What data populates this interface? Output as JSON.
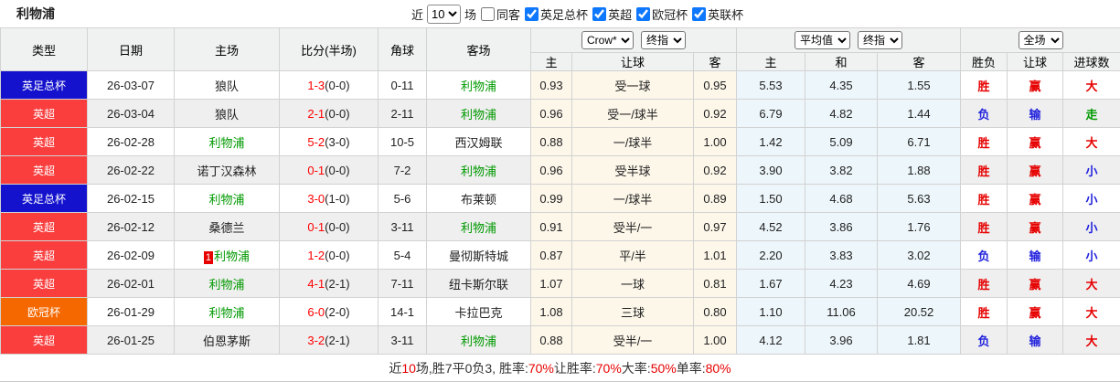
{
  "colors": {
    "league_red": "#fa3e3e",
    "league_blue": "#1412cd",
    "league_orange": "#f56800",
    "liverpool_green": "#009900",
    "score_red": "#ff0000",
    "win_red": "#e60000",
    "lose_blue": "#2222dd",
    "push_green": "#009900",
    "crow_col_bg": "#fdf7ea",
    "avg_col_bg": "#edf6fa",
    "checkbox_blue": "#0d77fe",
    "alt_row_gray": "#efefef"
  },
  "topbar": {
    "title": "利物浦",
    "recent_label": "近",
    "recent_value": "10",
    "games_label": "场",
    "filters": [
      {
        "label": "同客",
        "checked": false
      },
      {
        "label": "英足总杯",
        "checked": true
      },
      {
        "label": "英超",
        "checked": true
      },
      {
        "label": "欧冠杯",
        "checked": true
      },
      {
        "label": "英联杯",
        "checked": true
      }
    ]
  },
  "header": {
    "type": "类型",
    "date": "日期",
    "home": "主场",
    "score": "比分(半场)",
    "corner": "角球",
    "away": "客场",
    "selects": {
      "source": "Crow*",
      "final1": "终指",
      "avg": "平均值",
      "final2": "终指",
      "scope": "全场"
    },
    "crow_home": "主",
    "crow_handicap": "让球",
    "crow_away": "客",
    "avg_home": "主",
    "avg_draw": "和",
    "avg_away": "客",
    "res_wl": "胜负",
    "res_handicap": "让球",
    "res_goals": "进球数"
  },
  "table": {
    "rows": [
      {
        "league": "英足总杯",
        "date": "26-03-07",
        "home": "狼队",
        "home_rank": "",
        "score": "1-3",
        "half": "(0-0)",
        "corner": "0-11",
        "away": "利物浦",
        "o1": "0.93",
        "hc": "受一球",
        "o2": "0.95",
        "a1": "5.53",
        "a2": "4.35",
        "a3": "1.55",
        "r1": "胜",
        "r2": "赢",
        "r3": "大"
      },
      {
        "league": "英超",
        "date": "26-03-04",
        "home": "狼队",
        "home_rank": "",
        "score": "2-1",
        "half": "(0-0)",
        "corner": "2-11",
        "away": "利物浦",
        "o1": "0.96",
        "hc": "受一/球半",
        "o2": "0.92",
        "a1": "6.79",
        "a2": "4.82",
        "a3": "1.44",
        "r1": "负",
        "r2": "输",
        "r3": "走"
      },
      {
        "league": "英超",
        "date": "26-02-28",
        "home": "利物浦",
        "home_rank": "",
        "score": "5-2",
        "half": "(3-0)",
        "corner": "10-5",
        "away": "西汉姆联",
        "o1": "0.88",
        "hc": "一/球半",
        "o2": "1.00",
        "a1": "1.42",
        "a2": "5.09",
        "a3": "6.71",
        "r1": "胜",
        "r2": "赢",
        "r3": "大"
      },
      {
        "league": "英超",
        "date": "26-02-22",
        "home": "诺丁汉森林",
        "home_rank": "",
        "score": "0-1",
        "half": "(0-0)",
        "corner": "7-2",
        "away": "利物浦",
        "o1": "0.96",
        "hc": "受半球",
        "o2": "0.92",
        "a1": "3.90",
        "a2": "3.82",
        "a3": "1.88",
        "r1": "胜",
        "r2": "赢",
        "r3": "小"
      },
      {
        "league": "英足总杯",
        "date": "26-02-15",
        "home": "利物浦",
        "home_rank": "",
        "score": "3-0",
        "half": "(1-0)",
        "corner": "5-6",
        "away": "布莱顿",
        "o1": "0.99",
        "hc": "一/球半",
        "o2": "0.89",
        "a1": "1.50",
        "a2": "4.68",
        "a3": "5.63",
        "r1": "胜",
        "r2": "赢",
        "r3": "小"
      },
      {
        "league": "英超",
        "date": "26-02-12",
        "home": "桑德兰",
        "home_rank": "",
        "score": "0-1",
        "half": "(0-0)",
        "corner": "3-11",
        "away": "利物浦",
        "o1": "0.91",
        "hc": "受半/一",
        "o2": "0.97",
        "a1": "4.52",
        "a2": "3.86",
        "a3": "1.76",
        "r1": "胜",
        "r2": "赢",
        "r3": "小"
      },
      {
        "league": "英超",
        "date": "26-02-09",
        "home": "利物浦",
        "home_rank": "1",
        "score": "1-2",
        "half": "(0-0)",
        "corner": "5-4",
        "away": "曼彻斯特城",
        "o1": "0.87",
        "hc": "平/半",
        "o2": "1.01",
        "a1": "2.20",
        "a2": "3.83",
        "a3": "3.02",
        "r1": "负",
        "r2": "输",
        "r3": "小"
      },
      {
        "league": "英超",
        "date": "26-02-01",
        "home": "利物浦",
        "home_rank": "",
        "score": "4-1",
        "half": "(2-1)",
        "corner": "7-11",
        "away": "纽卡斯尔联",
        "o1": "1.07",
        "hc": "一球",
        "o2": "0.81",
        "a1": "1.67",
        "a2": "4.23",
        "a3": "4.69",
        "r1": "胜",
        "r2": "赢",
        "r3": "大"
      },
      {
        "league": "欧冠杯",
        "date": "26-01-29",
        "home": "利物浦",
        "home_rank": "",
        "score": "6-0",
        "half": "(2-0)",
        "corner": "14-1",
        "away": "卡拉巴克",
        "o1": "1.08",
        "hc": "三球",
        "o2": "0.80",
        "a1": "1.10",
        "a2": "11.06",
        "a3": "20.52",
        "r1": "胜",
        "r2": "赢",
        "r3": "大"
      },
      {
        "league": "英超",
        "date": "26-01-25",
        "home": "伯恩茅斯",
        "home_rank": "",
        "score": "3-2",
        "half": "(2-1)",
        "corner": "3-11",
        "away": "利物浦",
        "o1": "0.88",
        "hc": "受半/一",
        "o2": "1.00",
        "a1": "4.12",
        "a2": "3.96",
        "a3": "1.81",
        "r1": "负",
        "r2": "输",
        "r3": "大"
      }
    ]
  },
  "footer": {
    "p1": "近",
    "p2": "10",
    "p3": "场,胜7平0负3, 胜率:",
    "p4": "70%",
    "p5": " 让胜率:",
    "p6": "70%",
    "p7": " 大率:",
    "p8": "50%",
    "p9": " 单率:",
    "p10": "80%"
  }
}
